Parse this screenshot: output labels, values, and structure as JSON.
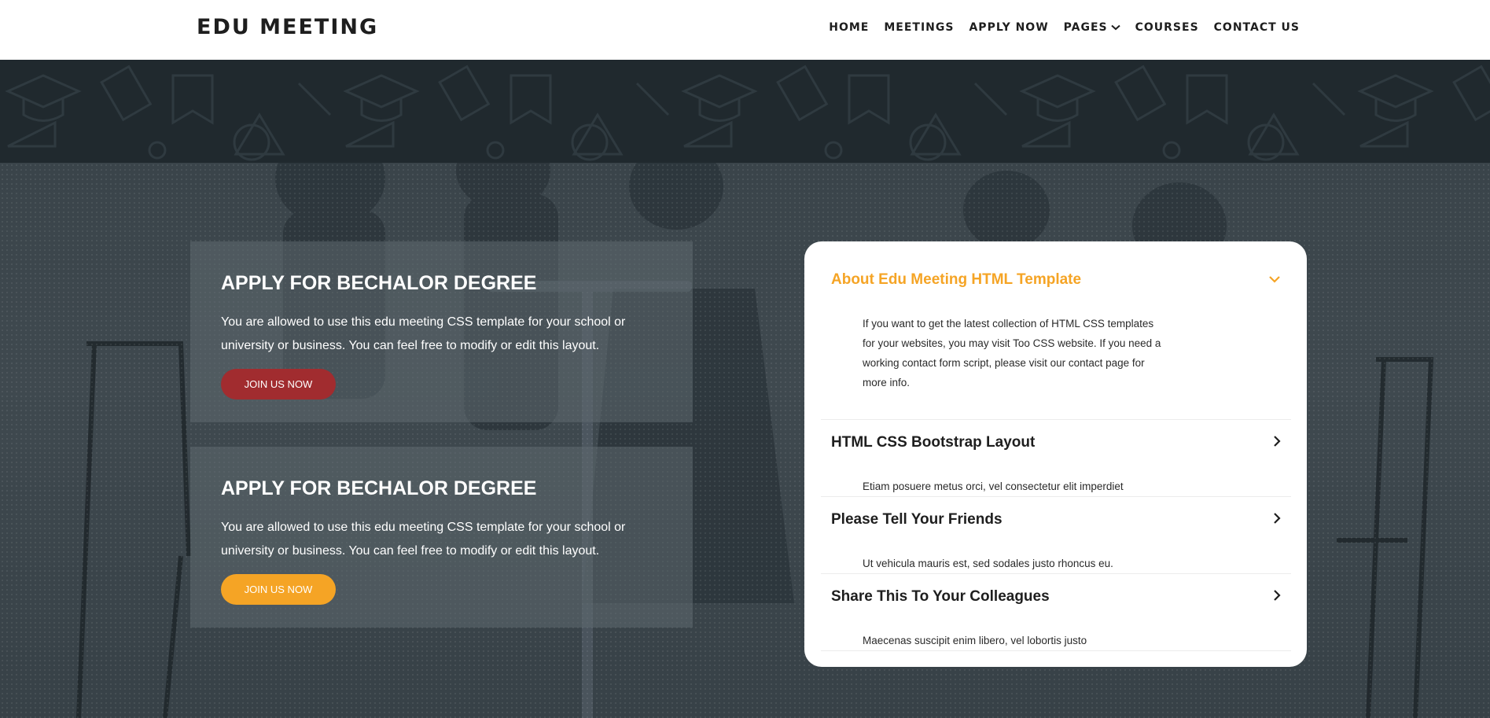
{
  "header": {
    "logo": "EDU MEETING",
    "nav": [
      {
        "label": "HOME"
      },
      {
        "label": "MEETINGS"
      },
      {
        "label": "APPLY NOW"
      },
      {
        "label": "PAGES",
        "icon": "chevron-down-icon"
      },
      {
        "label": "COURSES"
      },
      {
        "label": "CONTACT US"
      }
    ]
  },
  "cards": [
    {
      "title": "APPLY FOR BECHALOR DEGREE",
      "text": "You are allowed to use this edu meeting CSS template for your school or university or business. You can feel free to modify or edit this layout.",
      "button_label": "JOIN US NOW",
      "button_color": "#a12c2f"
    },
    {
      "title": "APPLY FOR BECHALOR DEGREE",
      "text": "You are allowed to use this edu meeting CSS template for your school or university or business. You can feel free to modify or edit this layout.",
      "button_label": "JOIN US NOW",
      "button_color": "#f5a425"
    }
  ],
  "accordion": {
    "accent_color": "#f5a425",
    "items": [
      {
        "title": "About Edu Meeting HTML Template",
        "body": "If you want to get the latest collection of HTML CSS templates for your websites, you may visit Too CSS website. If you need a working contact form script, please visit our contact page for more info.",
        "expanded": true,
        "icon": "chevron-down-icon"
      },
      {
        "title": "HTML CSS Bootstrap Layout",
        "body": "Etiam posuere metus orci, vel consectetur elit imperdiet",
        "expanded": false,
        "icon": "chevron-right-icon"
      },
      {
        "title": "Please Tell Your Friends",
        "body": "Ut vehicula mauris est, sed sodales justo rhoncus eu.",
        "expanded": false,
        "icon": "chevron-right-icon"
      },
      {
        "title": "Share This To Your Colleagues",
        "body": "Maecenas suscipit enim libero, vel lobortis justo",
        "expanded": false,
        "icon": "chevron-right-icon"
      }
    ]
  }
}
